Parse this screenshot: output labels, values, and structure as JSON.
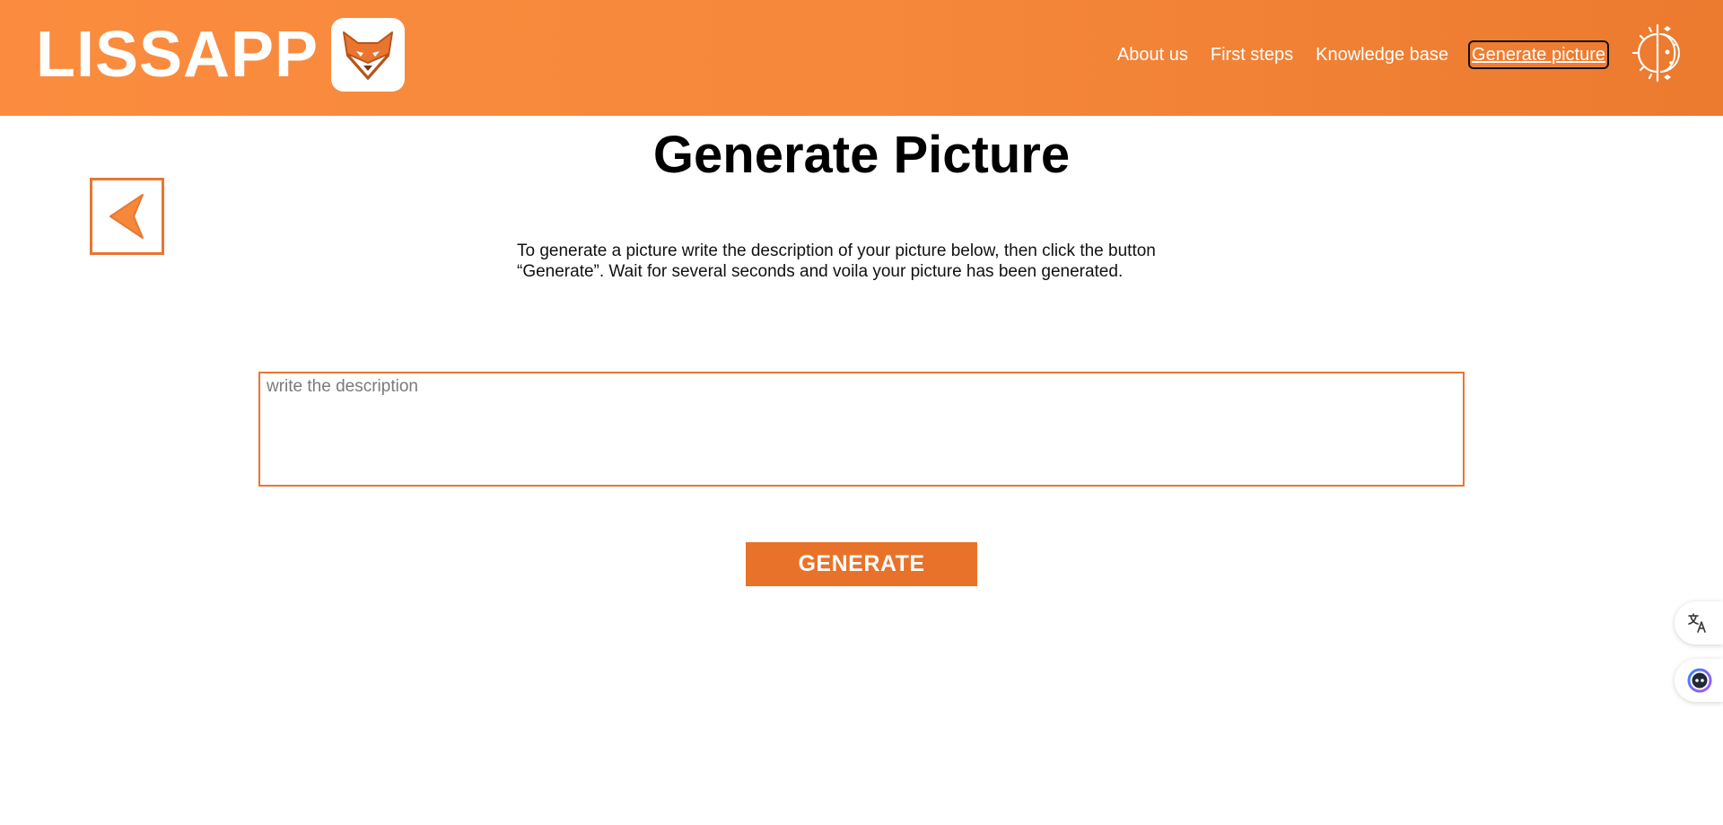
{
  "header": {
    "brand_name": "LISSAPP",
    "logo_icon": "fox-logo-icon",
    "nav": [
      {
        "label": "About us",
        "active": false
      },
      {
        "label": "First steps",
        "active": false
      },
      {
        "label": "Knowledge base",
        "active": false
      },
      {
        "label": "Generate picture",
        "active": true
      }
    ],
    "theme_toggle_icon": "sun-moon-theme-icon"
  },
  "main": {
    "title": "Generate Picture",
    "back_icon": "back-arrow-icon",
    "instructions": "To generate a picture write the description of your picture below, then click the button “Generate”. Wait for several seconds and voila your picture has been generated.",
    "description_input": {
      "value": "",
      "placeholder": "write the description"
    },
    "generate_label": "GENERATE"
  },
  "floating": {
    "translate_icon": "translate-icon",
    "assistant_icon": "assistant-icon"
  },
  "colors": {
    "brand_orange": "#f5883b",
    "accent_border": "#e97630",
    "button_bg": "#e8722a",
    "text": "#000000",
    "header_text": "#ffffff"
  }
}
